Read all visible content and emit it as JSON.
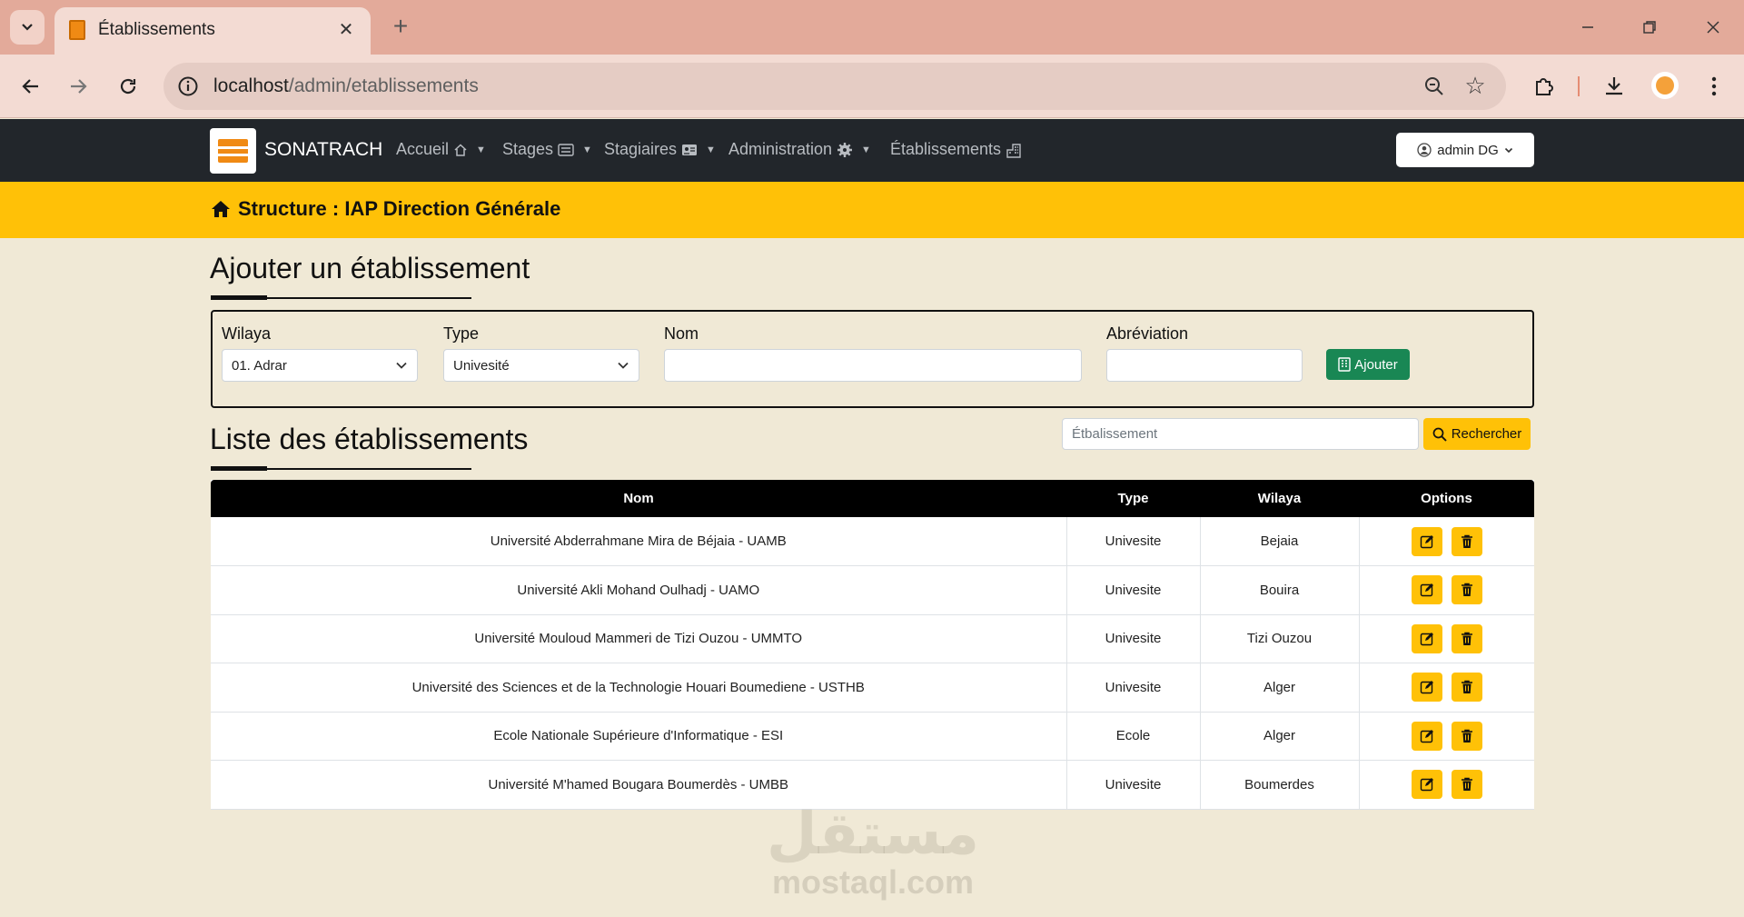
{
  "browser": {
    "tab_title": "Établissements",
    "url_host": "localhost",
    "url_path": "/admin/etablissements"
  },
  "navbar": {
    "brand": "SONATRACH",
    "menu": [
      {
        "label": "Accueil",
        "icon": "home-icon"
      },
      {
        "label": "Stages",
        "icon": "list-icon"
      },
      {
        "label": "Stagiaires",
        "icon": "id-card-icon"
      },
      {
        "label": "Administration",
        "icon": "gear-icon"
      },
      {
        "label": "Établissements",
        "icon": "building-icon"
      }
    ],
    "user": "admin DG"
  },
  "structure": {
    "title": "Structure : IAP Direction Générale"
  },
  "add_section": {
    "title": "Ajouter un établissement",
    "fields": {
      "wilaya_label": "Wilaya",
      "wilaya_value": "01. Adrar",
      "type_label": "Type",
      "type_value": "Univesité",
      "nom_label": "Nom",
      "nom_value": "",
      "abbr_label": "Abréviation",
      "abbr_value": ""
    },
    "add_button": "Ajouter"
  },
  "list_section": {
    "title": "Liste des établissements",
    "search_placeholder": "Étbalissement",
    "search_button": "Rechercher"
  },
  "table": {
    "headers": [
      "Nom",
      "Type",
      "Wilaya",
      "Options"
    ],
    "rows": [
      {
        "nom": "Université Abderrahmane Mira de Béjaia - UAMB",
        "type": "Univesite",
        "wilaya": "Bejaia"
      },
      {
        "nom": "Université Akli Mohand Oulhadj - UAMO",
        "type": "Univesite",
        "wilaya": "Bouira"
      },
      {
        "nom": "Université Mouloud Mammeri de Tizi Ouzou - UMMTO",
        "type": "Univesite",
        "wilaya": "Tizi Ouzou"
      },
      {
        "nom": "Université des Sciences et de la Technologie Houari Boumediene - USTHB",
        "type": "Univesite",
        "wilaya": "Alger"
      },
      {
        "nom": "Ecole Nationale Supérieure d'Informatique - ESI",
        "type": "Ecole",
        "wilaya": "Alger"
      },
      {
        "nom": "Université M'hamed Bougara Boumerdès - UMBB",
        "type": "Univesite",
        "wilaya": "Boumerdes"
      }
    ]
  },
  "watermark": {
    "arabic": "مستقل",
    "latin": "mostaql.com"
  },
  "colors": {
    "navbar": "#22262b",
    "structure_bar": "#ffc107",
    "page_bg": "#f0e9d6",
    "add_button": "#198754",
    "action_buttons": "#ffc107"
  }
}
